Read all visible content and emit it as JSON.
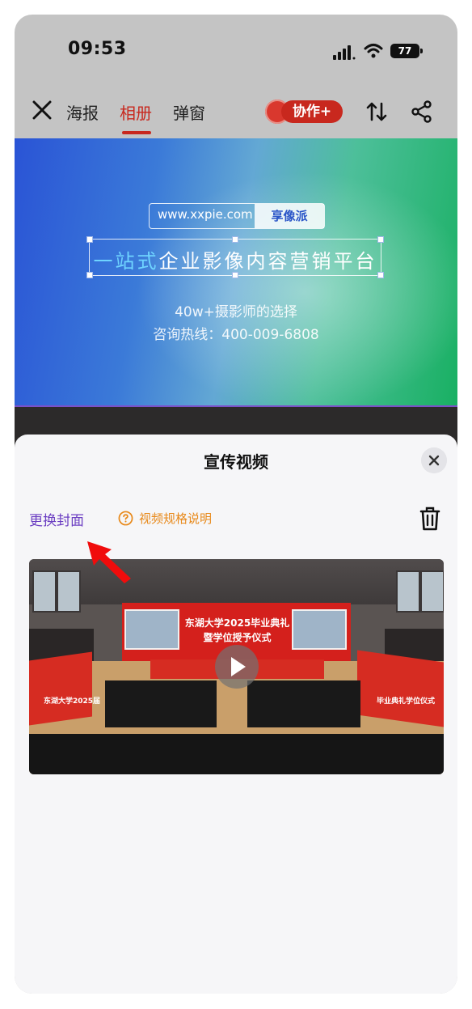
{
  "status_bar": {
    "time": "09:53",
    "battery": "77"
  },
  "nav": {
    "tabs": [
      {
        "label": "海报",
        "active": false
      },
      {
        "label": "相册",
        "active": true
      },
      {
        "label": "弹窗",
        "active": false
      }
    ],
    "collab_label": "协作+"
  },
  "banner": {
    "url": "www.xxpie.com",
    "brand": "享像派",
    "slogan_highlight": "一站式",
    "slogan_rest": "企业影像内容营销平台",
    "subtitle": "40w+摄影师的选择",
    "hotline": "咨询热线：400-009-6808"
  },
  "sheet": {
    "title": "宣传视频",
    "change_cover": "更换封面",
    "spec_link": "视频规格说明"
  },
  "video": {
    "banner_line1": "东湖大学2025毕业典礼",
    "banner_line2": "暨学位授予仪式",
    "side_left": "东湖大学2025届",
    "side_right": "毕业典礼学位仪式"
  },
  "colors": {
    "accent_red": "#c8281e",
    "purple": "#6c3fc2",
    "orange": "#e8891a"
  }
}
